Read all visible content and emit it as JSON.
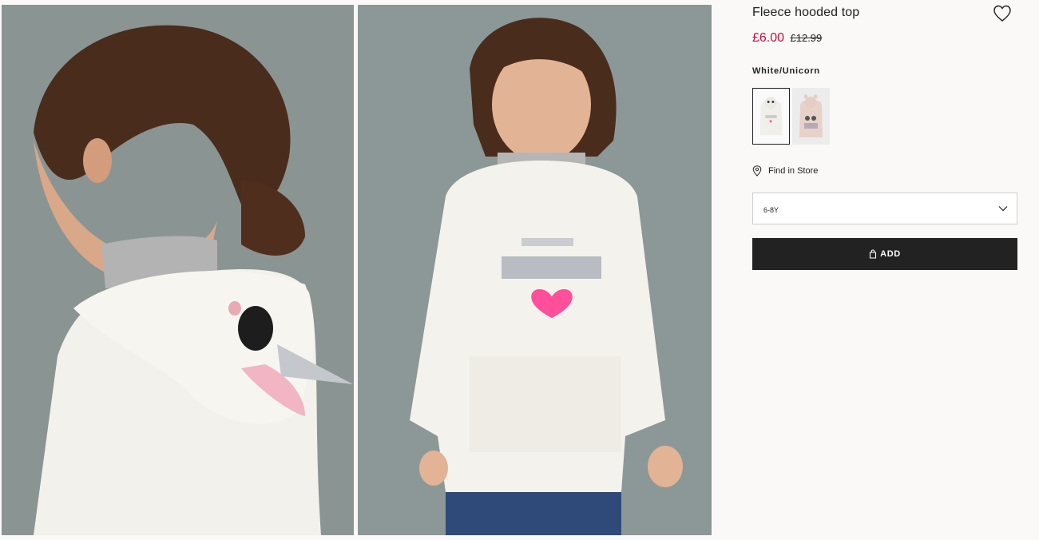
{
  "product": {
    "title": "Fleece hooded top",
    "price_current": "£6.00",
    "price_original": "£12.99",
    "color_name": "White/Unicorn",
    "find_in_store": "Find in Store",
    "size_selected": "6-8Y",
    "add_label": "ADD"
  },
  "swatches": [
    {
      "color": "#f4f2ee",
      "selected": true
    },
    {
      "color": "#e8d3cc",
      "selected": false
    }
  ],
  "icons": {
    "favorite": "heart-outline-icon",
    "location": "location-pin-icon",
    "dropdown": "chevron-down-icon",
    "bag": "shopping-bag-icon"
  },
  "colors": {
    "sale_price": "#c2103c",
    "add_button_bg": "#222222",
    "page_bg": "#faf9f8"
  }
}
